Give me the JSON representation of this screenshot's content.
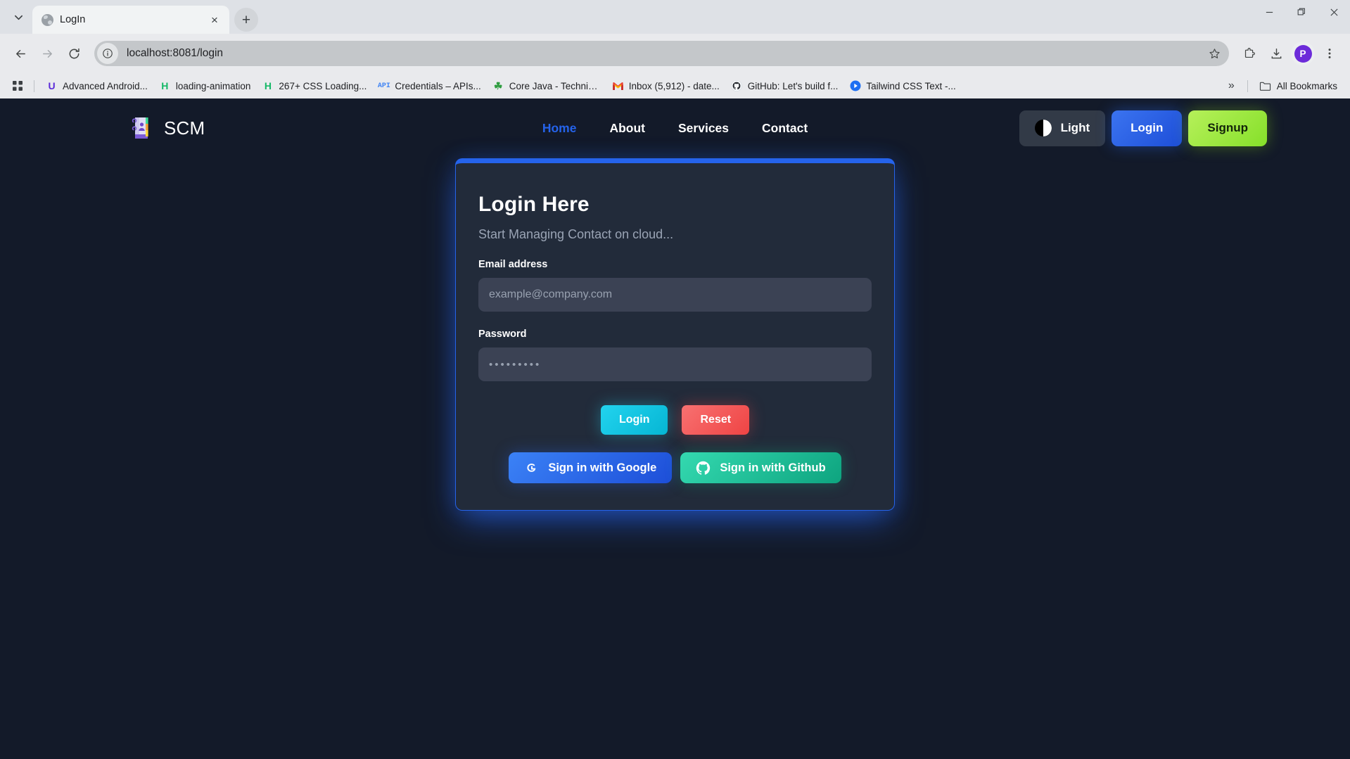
{
  "browser": {
    "tab": {
      "title": "LogIn",
      "favicon": "globe-icon",
      "close": "×"
    },
    "new_tab": "+",
    "window_controls": {
      "minimize": "—",
      "maximize": "❐",
      "close": "✕"
    },
    "nav": {
      "back": "←",
      "forward": "→",
      "reload": "⟳"
    },
    "omnibox": {
      "url": "localhost:8081/login",
      "info_icon": "site-info-icon",
      "star": "☆"
    },
    "toolbar_right": {
      "extensions": "extensions-icon",
      "downloads": "download-icon",
      "profile_initial": "P",
      "menu": "⋮"
    },
    "bookmarks": {
      "apps_icon": "apps-grid-icon",
      "items": [
        {
          "label": "Advanced Android...",
          "icon": "U",
          "color": "#5b2bd9"
        },
        {
          "label": "loading-animation",
          "icon": "H",
          "color": "#14b866"
        },
        {
          "label": "267+ CSS Loading...",
          "icon": "H",
          "color": "#14b866"
        },
        {
          "label": "Credentials – APIs...",
          "icon": "API",
          "color": "#4285f4"
        },
        {
          "label": "Core Java - Technica...",
          "icon": "☘",
          "color": "#2e9c3f"
        },
        {
          "label": "Inbox (5,912) - date...",
          "icon": "M",
          "color": "#ea4335"
        },
        {
          "label": "GitHub: Let's build f...",
          "icon": "●",
          "color": "#ffffff"
        },
        {
          "label": "Tailwind CSS Text -...",
          "icon": "▶",
          "color": "#1d6ff2"
        }
      ],
      "overflow": "»",
      "all_bookmarks": "All Bookmarks"
    }
  },
  "site": {
    "brand": {
      "name": "SCM",
      "logo_icon": "contact-book-icon"
    },
    "nav_links": [
      {
        "label": "Home",
        "active": true
      },
      {
        "label": "About",
        "active": false
      },
      {
        "label": "Services",
        "active": false
      },
      {
        "label": "Contact",
        "active": false
      }
    ],
    "actions": {
      "theme_toggle": "Light",
      "login": "Login",
      "signup": "Signup"
    }
  },
  "login_card": {
    "title": "Login Here",
    "subtitle": "Start Managing Contact on cloud...",
    "email": {
      "label": "Email address",
      "value": "",
      "placeholder": "example@company.com"
    },
    "password": {
      "label": "Password",
      "value": "",
      "placeholder": "•••••••••"
    },
    "submit": "Login",
    "reset": "Reset",
    "google": "Sign in with Google",
    "github": "Sign in with Github"
  },
  "colors": {
    "page_bg": "#131a29",
    "card_bg": "#222b3a",
    "accent_blue": "#2563eb",
    "input_bg": "#3b4254",
    "cyan": "#06b6d4",
    "red": "#ef4444",
    "lime": "#86e02a",
    "teal": "#0ea47f"
  }
}
